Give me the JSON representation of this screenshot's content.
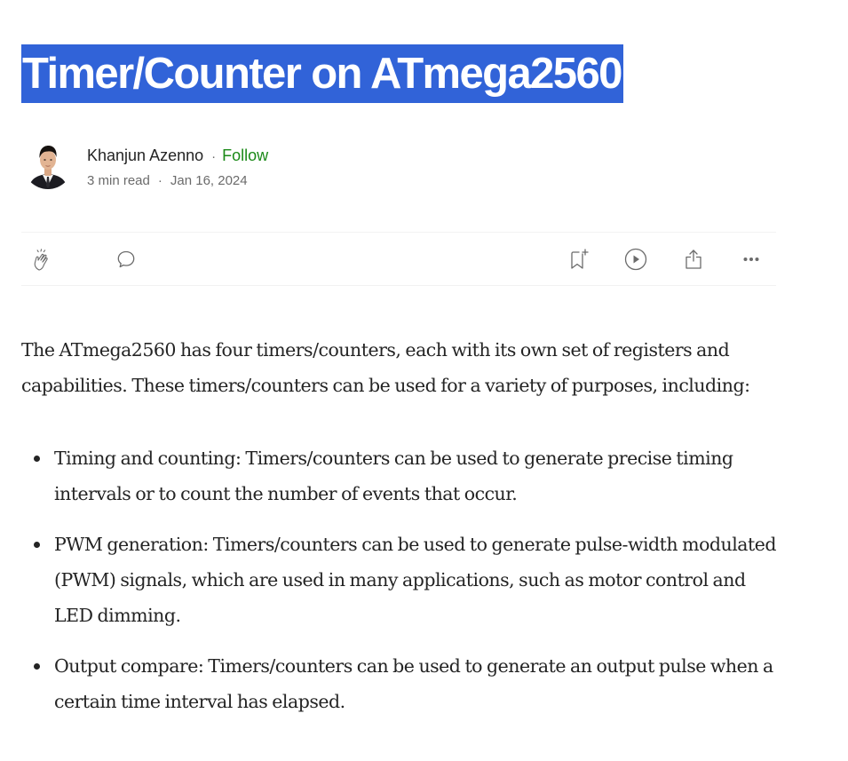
{
  "article": {
    "title": "Timer/Counter on ATmega2560",
    "author": {
      "name": "Khanjun Azenno",
      "separator": "·",
      "follow_label": "Follow",
      "read_time": "3 min read",
      "date": "Jan 16, 2024"
    },
    "actions": {
      "clap_icon": "clap-icon",
      "comment_icon": "comment-icon",
      "bookmark_icon": "bookmark-add-icon",
      "listen_icon": "play-circle-icon",
      "share_icon": "share-icon",
      "more_icon": "more-horizontal-icon"
    },
    "intro": "The ATmega2560 has four timers/counters, each with its own set of registers and capabilities. These timers/counters can be used for a variety of purposes, including:",
    "bullets": [
      "Timing and counting: Timers/counters can be used to generate precise timing intervals or to count the number of events that occur.",
      "PWM generation: Timers/counters can be used to generate pulse-width modulated (PWM) signals, which are used in many applications, such as motor control and LED dimming.",
      "Output compare: Timers/counters can be used to generate an output pulse when a certain time interval has elapsed."
    ]
  },
  "colors": {
    "title_highlight": "#3163d8",
    "text": "#242424",
    "muted": "#6b6b6b",
    "follow": "#1a8917",
    "divider": "#f2f2f2"
  }
}
